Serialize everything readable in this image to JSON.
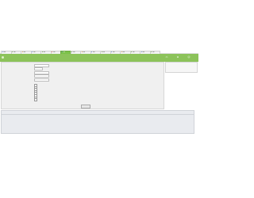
{
  "tabs": [
    {
      "label": "Tab",
      "color": "#5b8fd6"
    },
    {
      "label": "Tab",
      "color": "#6aa93e"
    },
    {
      "label": "Tab",
      "color": "#e39a2d"
    },
    {
      "label": "Tab",
      "color": "#5b8fd6"
    },
    {
      "label": "Tab",
      "color": "#6aa93e"
    },
    {
      "label": "Tab",
      "color": "#e3543d"
    },
    {
      "label": "Tab",
      "color": "#5b8fd6"
    },
    {
      "label": "Tab",
      "color": "#6aa93e"
    },
    {
      "label": "Tab",
      "color": "#e39a2d"
    },
    {
      "label": "Tab",
      "color": "#5b8fd6"
    },
    {
      "label": "Tab",
      "color": "#6aa93e"
    },
    {
      "label": "Tab",
      "color": "#5b8fd6"
    },
    {
      "label": "Tab",
      "color": "#e39a2d"
    },
    {
      "label": "Tab",
      "color": "#6aa93e"
    },
    {
      "label": "Tab",
      "color": "#5b8fd6"
    },
    {
      "label": "Tab",
      "color": "#6aa93e"
    }
  ],
  "header": {
    "title": "",
    "icons": [
      {
        "name": "monitor-icon",
        "glyph": "▭",
        "label": ""
      },
      {
        "name": "tools-icon",
        "glyph": "⚙",
        "label": ""
      },
      {
        "name": "user-icon",
        "glyph": "☺",
        "label": ""
      }
    ]
  },
  "form": {
    "fields": [
      {
        "label": "",
        "kind": "input"
      },
      {
        "label": "",
        "kind": "input-sm"
      },
      {
        "label": "",
        "kind": "input"
      },
      {
        "label": "",
        "kind": "input"
      },
      {
        "label": "",
        "kind": "input"
      }
    ],
    "checks": [
      {
        "label": ""
      },
      {
        "label": ""
      },
      {
        "label": ""
      },
      {
        "label": ""
      },
      {
        "label": ""
      },
      {
        "label": ""
      },
      {
        "label": ""
      },
      {
        "label": ""
      }
    ],
    "submit_label": ""
  },
  "sidebar": {
    "lines": [
      "",
      "",
      ""
    ]
  },
  "lower": {
    "title": "",
    "lines": [
      "",
      "",
      "",
      "",
      ""
    ]
  },
  "colors": {
    "accent": "#8cc35a",
    "active_tab": "#7cc24a"
  }
}
